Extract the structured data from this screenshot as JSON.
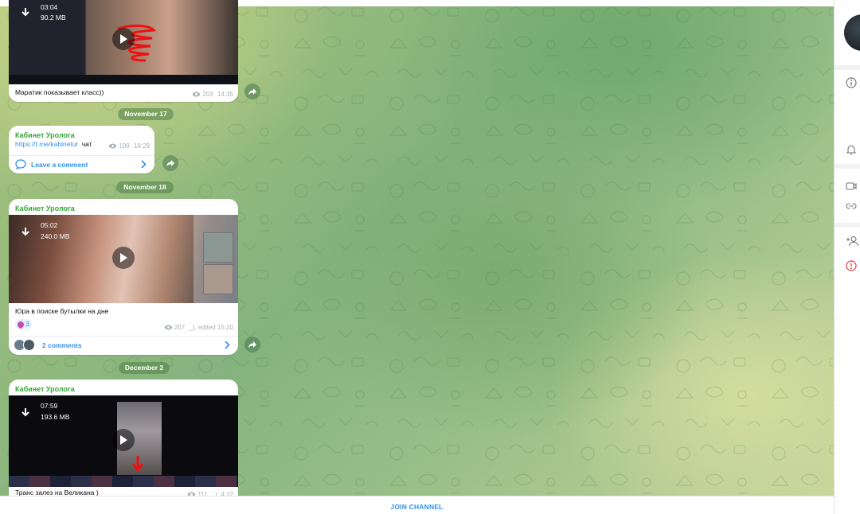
{
  "channel_name": "Кабинет Уролога",
  "messages": [
    {
      "duration": "03:04",
      "size": "90.2 MB",
      "caption": "Маратик показывает класс))",
      "views": "203",
      "time": "14:35"
    },
    {
      "link": "https://t.me/kabinetur",
      "link_suffix": "чат",
      "views": "199",
      "time": "18:29",
      "comments_label": "Leave a comment"
    },
    {
      "duration": "05:02",
      "size": "240.0 MB",
      "caption": "Юра в поиске бутылки на дне",
      "reaction_count": "3",
      "views": "207",
      "time_meta": "_), edited 15:20",
      "comments_label": "2 comments"
    },
    {
      "duration": "07:59",
      "size": "193.6 MB",
      "caption": "Транс залез на Великана )",
      "views": "111",
      "time_meta": "_), 4:12"
    }
  ],
  "dates": [
    "November 17",
    "November 18",
    "December 2"
  ],
  "join_label": "JOIN CHANNEL",
  "colors": {
    "accent": "#3390ec",
    "author": "#3aa53a",
    "date_pill": "#5a8c4c"
  },
  "right_panel_icons": [
    "info-icon",
    "bell-icon",
    "video-icon",
    "link-icon",
    "add-user-icon",
    "report-icon"
  ]
}
